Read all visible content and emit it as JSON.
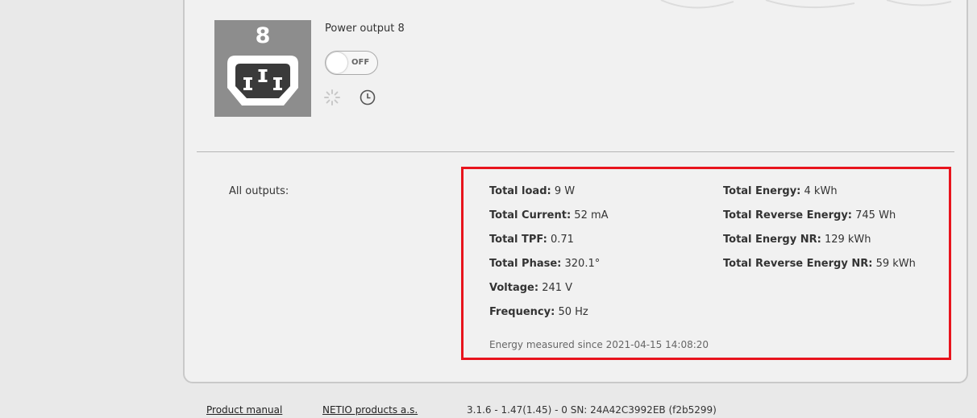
{
  "colors": {
    "highlight": "#e8141d",
    "tile": "#8d8d8d",
    "page_bg": "#e9e9e9",
    "panel_bg": "#f1f1f1"
  },
  "output": {
    "number": "8",
    "name": "Power output 8",
    "state_label": "OFF",
    "icons": [
      "power-socket-icon",
      "spinner-icon",
      "clock-icon"
    ]
  },
  "summary": {
    "label": "All outputs:",
    "left_column": [
      {
        "key": "Total load:",
        "value": "9 W"
      },
      {
        "key": "Total Current:",
        "value": "52 mA"
      },
      {
        "key": "Total TPF:",
        "value": "0.71"
      },
      {
        "key": "Total Phase:",
        "value": "320.1°"
      },
      {
        "key": "Voltage:",
        "value": "241 V"
      },
      {
        "key": "Frequency:",
        "value": "50 Hz"
      }
    ],
    "right_column": [
      {
        "key": "Total Energy:",
        "value": "4 kWh"
      },
      {
        "key": "Total Reverse Energy:",
        "value": "745 Wh"
      },
      {
        "key": "Total Energy NR:",
        "value": "129 kWh"
      },
      {
        "key": "Total Reverse Energy NR:",
        "value": "59 kWh"
      }
    ],
    "measured_since": "Energy measured since 2021-04-15 14:08:20"
  },
  "footer": {
    "manual_link": "Product manual",
    "company_link": "NETIO products a.s.",
    "version": "3.1.6 - 1.47(1.45) - 0 SN: 24A42C3992EB (f2b5299)"
  }
}
